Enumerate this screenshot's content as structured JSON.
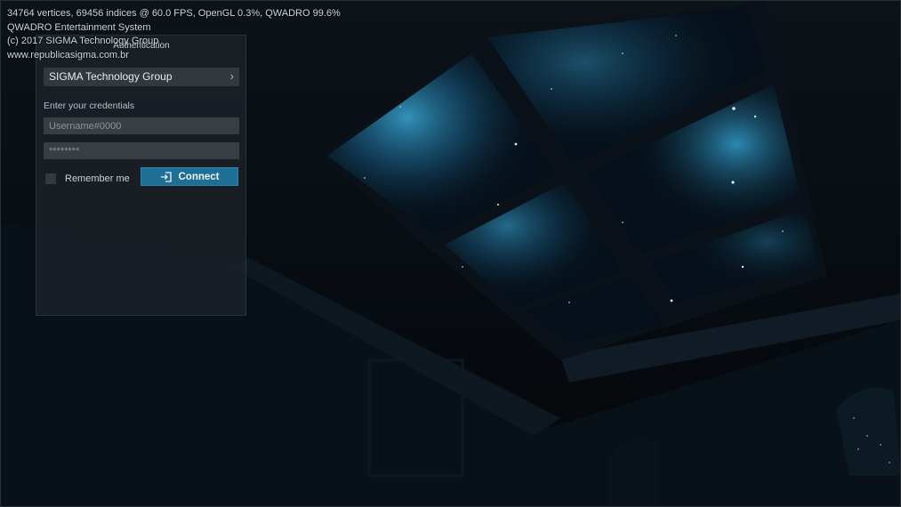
{
  "overlay": {
    "stats": "34764 vertices, 69456 indices @ 60.0 FPS, OpenGL 0.3%, QWADRO 99.6%",
    "engine": "QWADRO Entertainment System",
    "copyright": "(c) 2017 SIGMA Technology Group",
    "website": "www.republicasigma.com.br"
  },
  "auth": {
    "title": "Authentication",
    "server": "SIGMA Technology Group",
    "server_chevron": "›",
    "credentials_label": "Enter your credentials",
    "username_placeholder": "Username#0000",
    "password_placeholder": "********",
    "remember_label": "Remember me",
    "connect_label": "Connect",
    "connect_icon": "login-icon"
  },
  "colors": {
    "accent": "#1f6e93",
    "nebula": "#2a9ccf",
    "background": "#05080c"
  }
}
